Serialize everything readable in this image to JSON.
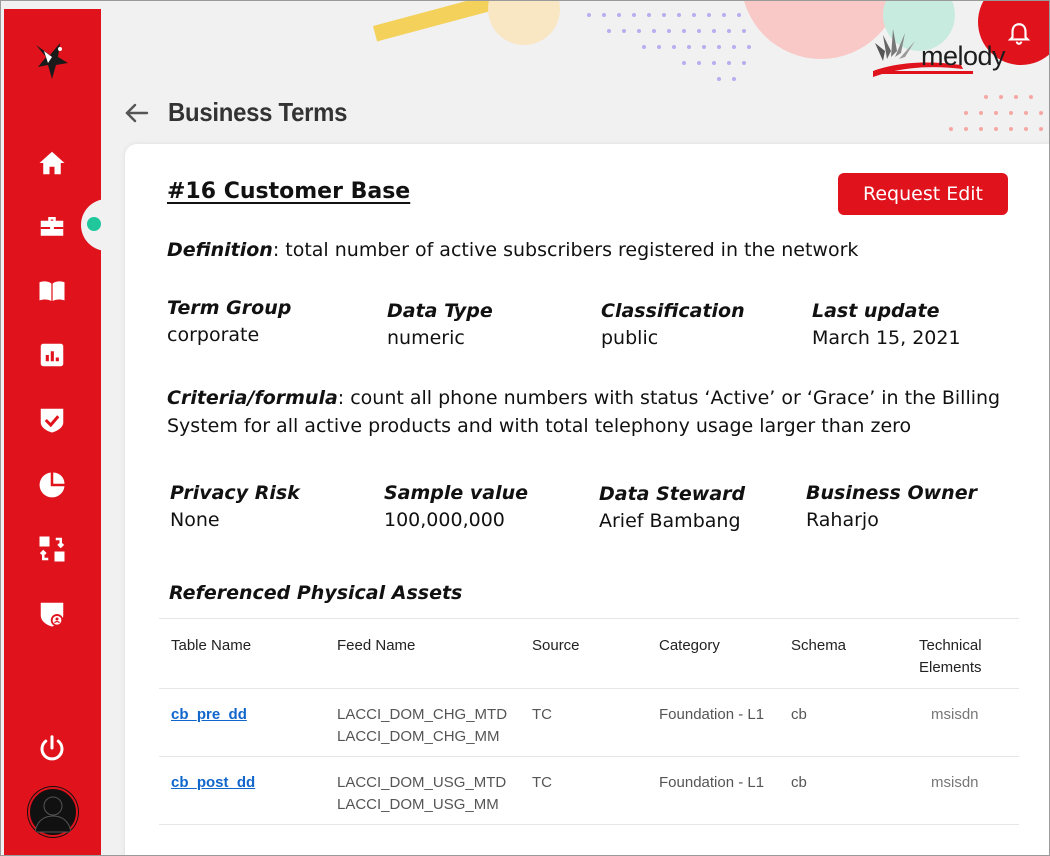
{
  "app": {
    "brand": "melody",
    "page_title": "Business Terms",
    "colors": {
      "primary": "#e0131d",
      "active_indicator": "#1fc79a",
      "link": "#1166cc"
    }
  },
  "sidebar": {
    "items": [
      {
        "name": "home",
        "icon": "home-icon"
      },
      {
        "name": "business-terms",
        "icon": "briefcase-icon",
        "active": true
      },
      {
        "name": "glossary",
        "icon": "book-icon"
      },
      {
        "name": "reports",
        "icon": "bar-chart-icon"
      },
      {
        "name": "approvals",
        "icon": "shield-check-icon"
      },
      {
        "name": "analytics",
        "icon": "pie-chart-icon"
      },
      {
        "name": "data-flow",
        "icon": "transfer-icon"
      },
      {
        "name": "privacy",
        "icon": "shield-user-icon"
      },
      {
        "name": "logout",
        "icon": "power-icon"
      }
    ]
  },
  "term": {
    "title": "#16 Customer Base",
    "request_edit_label": "Request Edit",
    "definition_label": "Definition",
    "definition_text": ": total number of active subscribers registered in the network",
    "fields_row1": [
      {
        "label": "Term Group",
        "value": "corporate"
      },
      {
        "label": "Data Type",
        "value": "numeric"
      },
      {
        "label": "Classification",
        "value": "public"
      },
      {
        "label": "Last update",
        "value": "March 15, 2021"
      }
    ],
    "criteria_label": "Criteria/formula",
    "criteria_text": ": count all phone numbers with status ‘Active’ or ‘Grace’ in the Billing System for all active products and with total telephony usage larger than zero",
    "fields_row2": [
      {
        "label": "Privacy Risk",
        "value": "None"
      },
      {
        "label": "Sample value",
        "value": "100,000,000"
      },
      {
        "label": "Data Steward",
        "value": "Arief Bambang"
      },
      {
        "label": "Business Owner",
        "value": "Raharjo"
      }
    ]
  },
  "assets": {
    "title": "Referenced Physical Assets",
    "columns": [
      "Table Name",
      "Feed Name",
      "Source",
      "Category",
      "Schema",
      "Technical Elements"
    ],
    "rows": [
      {
        "table_name": "cb_pre_dd",
        "feed_1": "LACCI_DOM_CHG_MTD",
        "feed_2": "LACCI_DOM_CHG_MM",
        "source": "TC",
        "category": "Foundation - L1",
        "schema": "cb",
        "technical": "msisdn"
      },
      {
        "table_name": "cb_post_dd",
        "feed_1": "LACCI_DOM_USG_MTD",
        "feed_2": "LACCI_DOM_USG_MM",
        "source": "TC",
        "category": "Foundation - L1",
        "schema": "cb",
        "technical": "msisdn"
      }
    ]
  }
}
